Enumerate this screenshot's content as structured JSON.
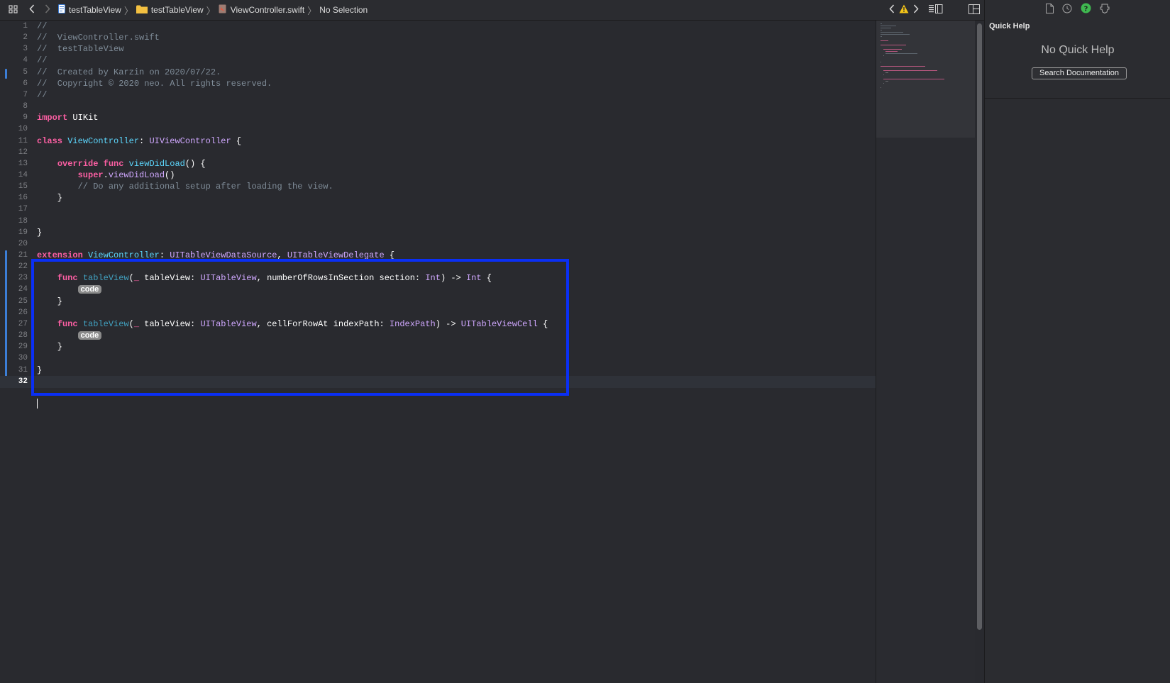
{
  "breadcrumb": {
    "project": "testTableView",
    "group": "testTableView",
    "file": "ViewController.swift",
    "selection": "No Selection"
  },
  "colors": {
    "keyword": "#fc5fa3",
    "type_decl": "#5dd8ff",
    "type_ref": "#d0a8ff",
    "comment": "#7f8c98",
    "highlight_box": "#0a2ff5"
  },
  "icons": {
    "grid": "grid-icon",
    "back": "chevron-left-icon",
    "forward": "chevron-right-icon",
    "warning": "warning-triangle-icon",
    "file_inspector": "file-icon",
    "history": "clock-icon",
    "quick_help": "question-icon",
    "attributes": "shield-icon"
  },
  "editor": {
    "lines": [
      {
        "n": "1",
        "html": "<span class='cm'>//</span>"
      },
      {
        "n": "2",
        "html": "<span class='cm'>//  ViewController.swift</span>"
      },
      {
        "n": "3",
        "html": "<span class='cm'>//  testTableView</span>"
      },
      {
        "n": "4",
        "html": "<span class='cm'>//</span>"
      },
      {
        "n": "5",
        "html": "<span class='cm'>//  Created by Karzin on 2020/07/22.</span>"
      },
      {
        "n": "6",
        "html": "<span class='cm'>//  Copyright © 2020 neo. All rights reserved.</span>"
      },
      {
        "n": "7",
        "html": "<span class='cm'>//</span>"
      },
      {
        "n": "8",
        "html": ""
      },
      {
        "n": "9",
        "html": "<span class='kw'>import</span> UIKit"
      },
      {
        "n": "10",
        "html": ""
      },
      {
        "n": "11",
        "html": "<span class='kw'>class</span> <span class='ty'>ViewController</span>: <span class='tyx'>UIViewController</span> {"
      },
      {
        "n": "12",
        "html": ""
      },
      {
        "n": "13",
        "html": "    <span class='kw'>override</span> <span class='kw'>func</span> <span class='ty'>viewDidLoad</span>() {"
      },
      {
        "n": "14",
        "html": "        <span class='kw'>super</span>.<span class='tyx'>viewDidLoad</span>()"
      },
      {
        "n": "15",
        "html": "        <span class='cm'>// Do any additional setup after loading the view.</span>"
      },
      {
        "n": "16",
        "html": "    }"
      },
      {
        "n": "17",
        "html": ""
      },
      {
        "n": "18",
        "html": ""
      },
      {
        "n": "19",
        "html": "}"
      },
      {
        "n": "20",
        "html": ""
      },
      {
        "n": "21",
        "html": "<span class='kw'>extension</span> <span class='ty'>ViewController</span>: <span class='tyx'>UITableViewDataSource</span>, <span class='tyx'>UITableViewDelegate</span> {"
      },
      {
        "n": "22",
        "html": ""
      },
      {
        "n": "23",
        "html": "    <span class='kw'>func</span> <span class='fnc'>tableView</span>(<span class='kw'>_</span> tableView: <span class='tyx'>UITableView</span>, numberOfRowsInSection section: <span class='tyx'>Int</span>) -> <span class='tyx'>Int</span> {"
      },
      {
        "n": "24",
        "html": "        <span class='ph'>code</span>"
      },
      {
        "n": "25",
        "html": "    }"
      },
      {
        "n": "26",
        "html": ""
      },
      {
        "n": "27",
        "html": "    <span class='kw'>func</span> <span class='fnc'>tableView</span>(<span class='kw'>_</span> tableView: <span class='tyx'>UITableView</span>, cellForRowAt indexPath: <span class='tyx'>IndexPath</span>) -> <span class='tyx'>UITableViewCell</span> {"
      },
      {
        "n": "28",
        "html": "        <span class='ph'>code</span>"
      },
      {
        "n": "29",
        "html": "    }"
      },
      {
        "n": "30",
        "html": ""
      },
      {
        "n": "31",
        "html": "}"
      },
      {
        "n": "32",
        "html": ""
      }
    ],
    "active_line": "32"
  },
  "inspector": {
    "title": "Quick Help",
    "empty_message": "No Quick Help",
    "search_button": "Search Documentation"
  }
}
